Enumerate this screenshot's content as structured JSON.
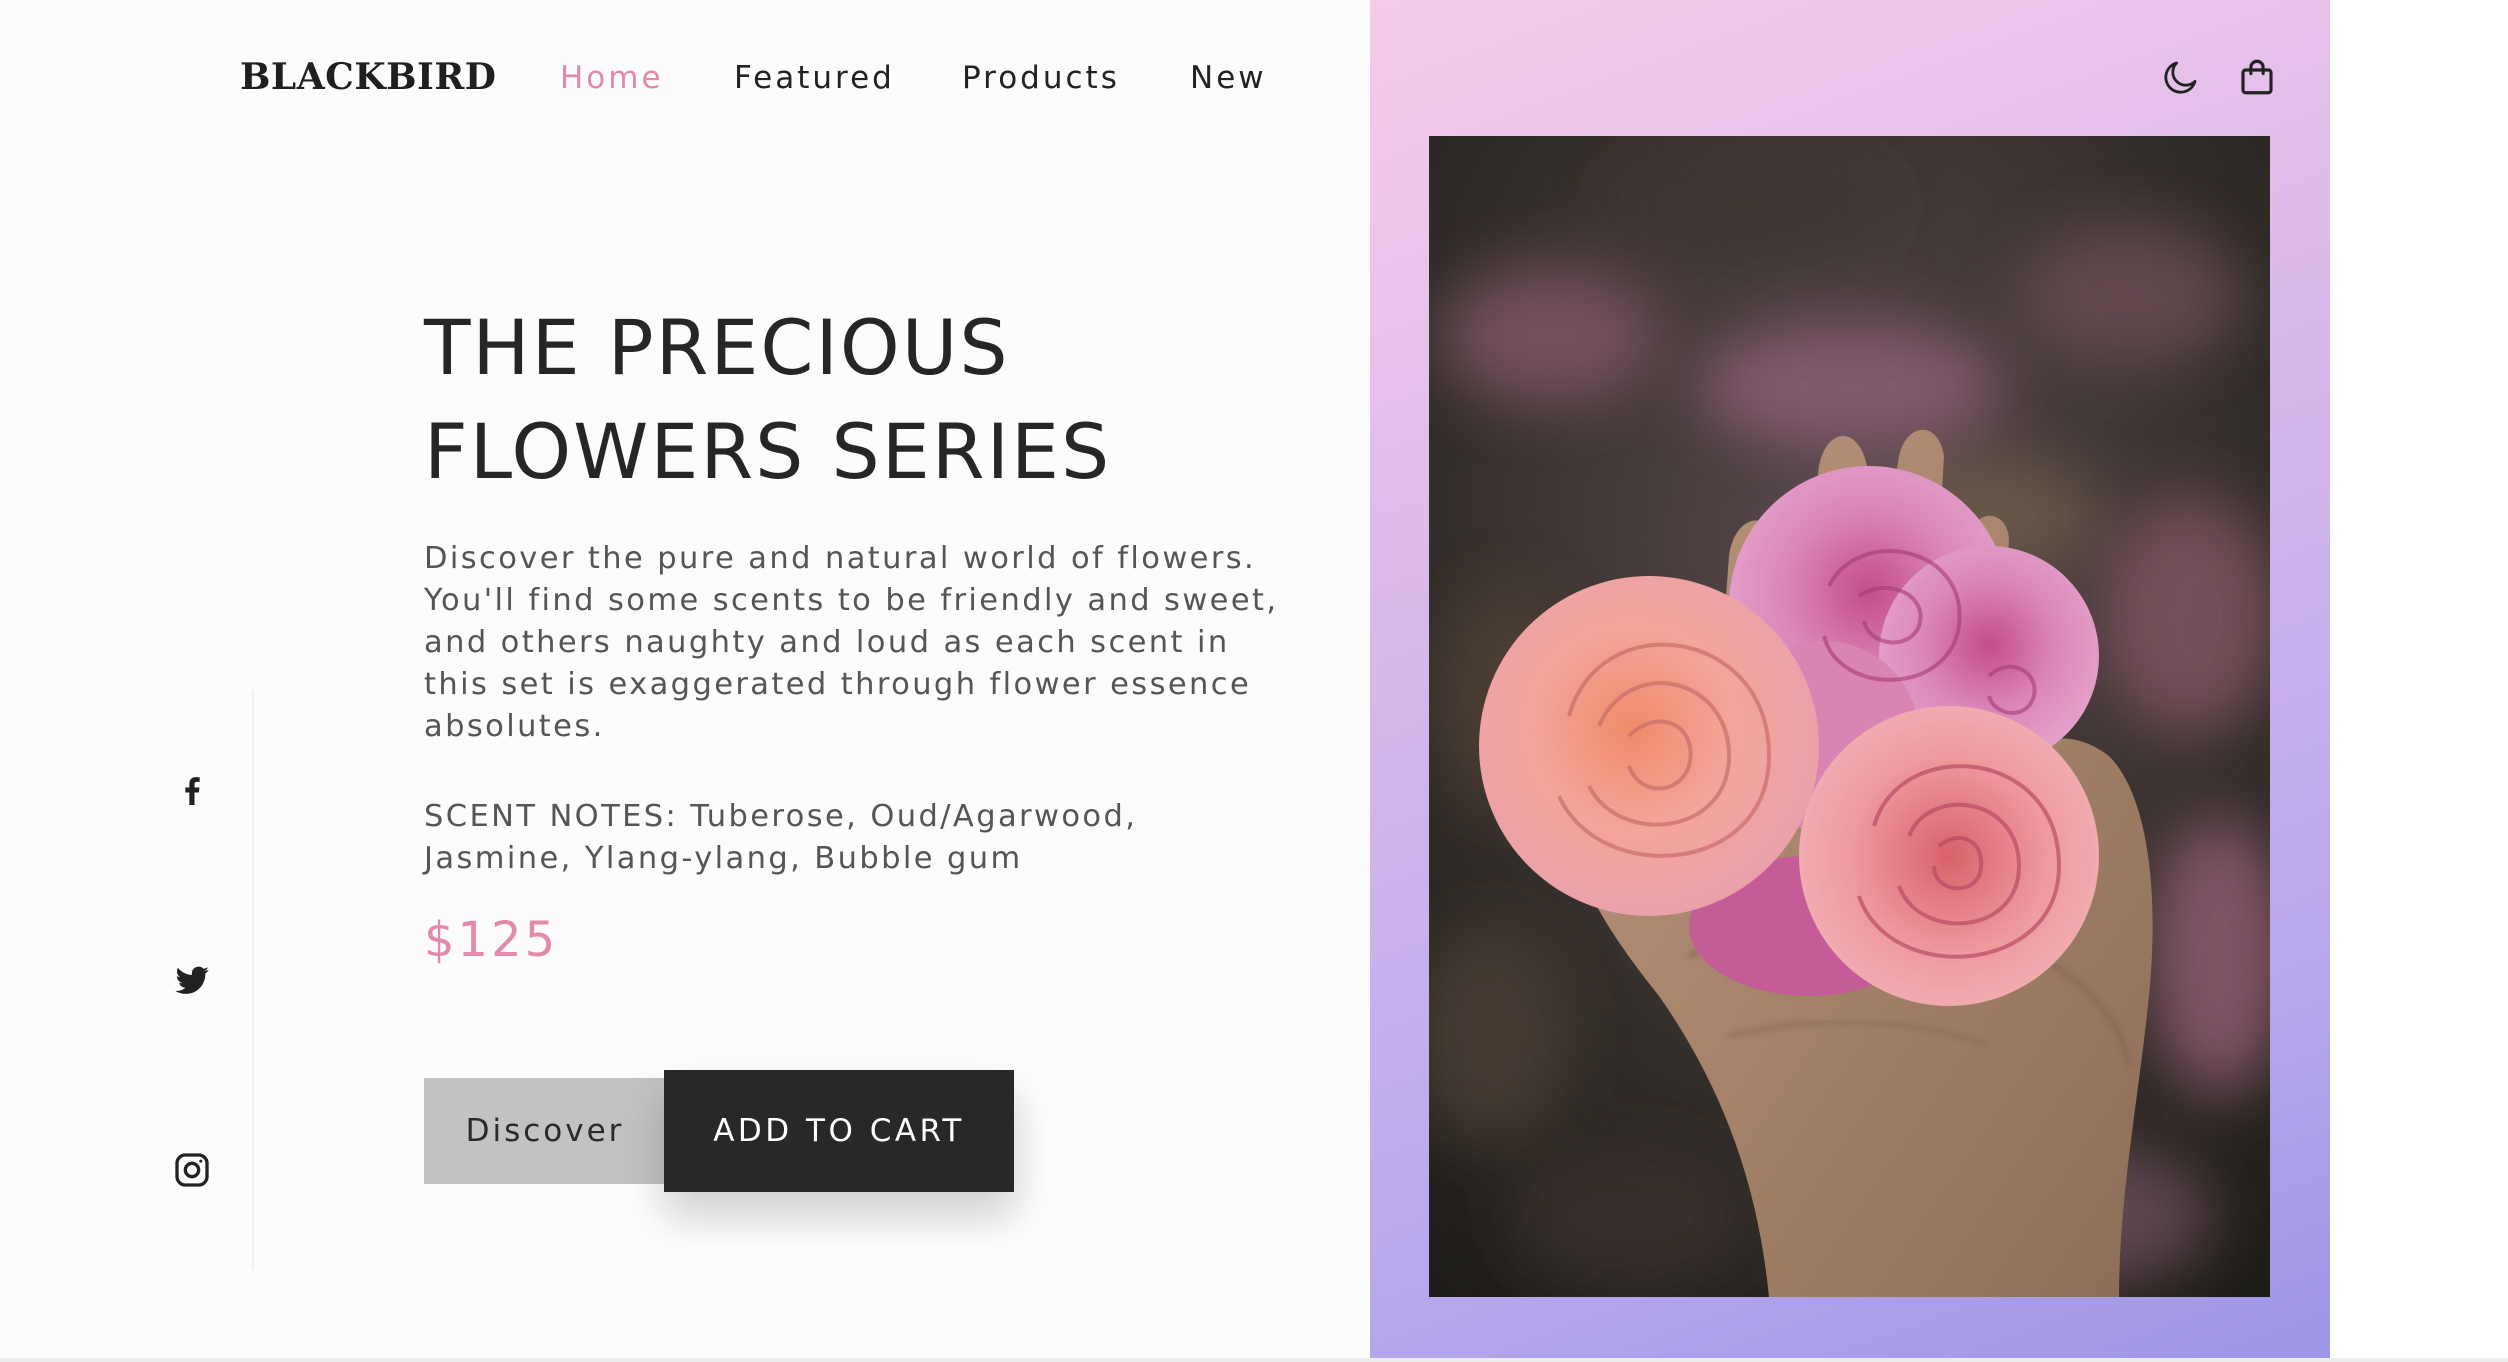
{
  "brand": {
    "logo": "BLACKBIRD"
  },
  "nav": {
    "items": [
      {
        "label": "Home",
        "active": true
      },
      {
        "label": "Featured",
        "active": false
      },
      {
        "label": "Products",
        "active": false
      },
      {
        "label": "New",
        "active": false
      }
    ]
  },
  "header_icons": [
    "moon-icon",
    "shopping-bag-icon"
  ],
  "hero": {
    "title_lines": [
      "THE PRECIOUS",
      "FLOWERS SERIES"
    ],
    "description_lines": [
      "Discover the pure and natural world of flowers.",
      "You'll find some scents to be friendly and sweet,",
      "and others naughty and loud as each scent in",
      "this set is exaggerated through flower essence",
      "absolutes."
    ],
    "scent_lines": [
      "SCENT NOTES: Tuberose, Oud/Agarwood,",
      "Jasmine, Ylang-ylang, Bubble gum"
    ],
    "price": "$125"
  },
  "buttons": {
    "discover": "Discover",
    "add_to_cart": "ADD TO CART"
  },
  "social": [
    "facebook-icon",
    "twitter-icon",
    "instagram-icon"
  ],
  "colors": {
    "accent": "#e48aa8",
    "text_dark": "#262626",
    "text_body": "#555555",
    "button_dark": "#282828",
    "button_light": "#c2c2c2",
    "gradient_start": "#f6cbe9",
    "gradient_end": "#9d95e6"
  }
}
